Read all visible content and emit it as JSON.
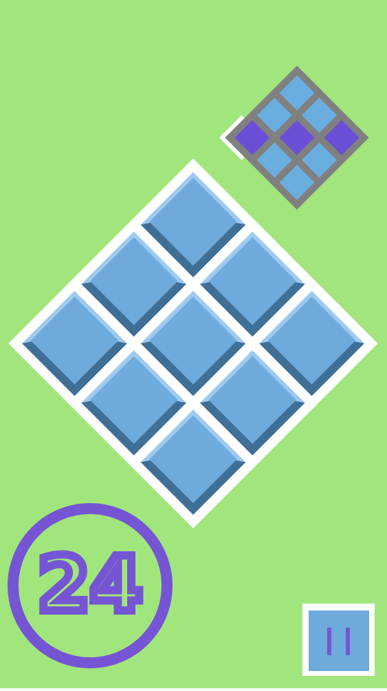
{
  "game": {
    "score": "24",
    "colors": {
      "background": "#a1e67c",
      "board_frame": "#ffffff",
      "tile_top": "#6eaadb",
      "tile_side_dark": "#3f6f97",
      "tile_side_light": "#9fcaf0",
      "preview_frame": "#808080",
      "preview_tile": "#6aaee0",
      "preview_target": "#6a4fd6",
      "score_accent": "#7655d4",
      "pause_bg": "#6eaadb",
      "pause_icon": "#7655d4"
    },
    "icons": {
      "pause": "pause-icon"
    },
    "board": {
      "rows": 3,
      "cols": 3
    },
    "target_pattern": [
      [
        0,
        0,
        1
      ],
      [
        0,
        1,
        0
      ],
      [
        1,
        0,
        0
      ]
    ],
    "target_pattern_note_visible": false
  }
}
